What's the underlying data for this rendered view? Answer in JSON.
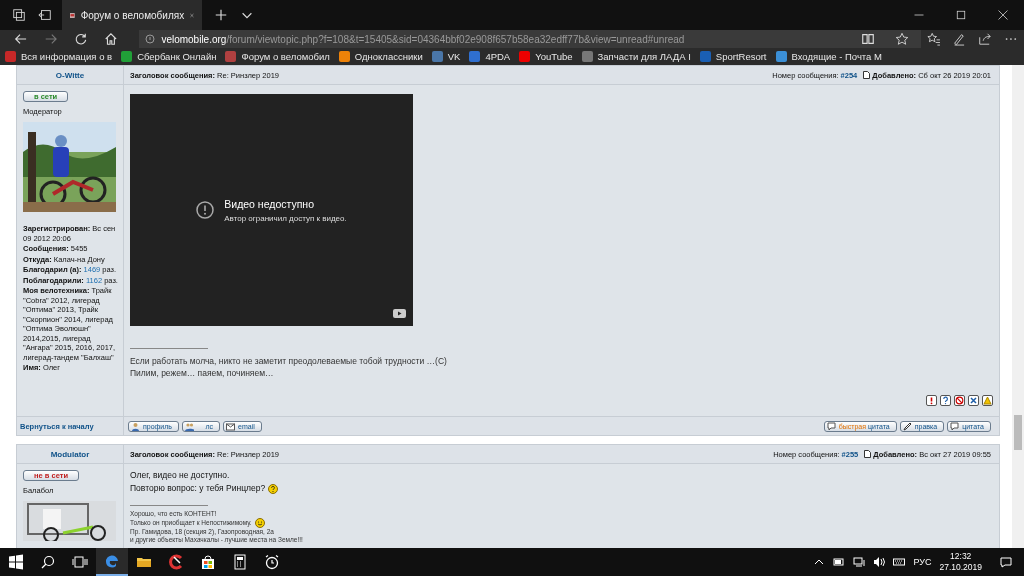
{
  "browser": {
    "tabs": [
      {
        "title": "Форум о веломобилях",
        "selected": true
      }
    ],
    "address": "**velomobile.org**/forum/viewtopic.php?f=108&t=15405&sid=04364bbf02e908f657b58ea32edff77b&view=unread#unread",
    "bookmarks": [
      "Вся информация о в",
      "Сбербанк Онлайн",
      "Форум о веломобил",
      "Одноклассники",
      "VK",
      "4PDA",
      "YouTube",
      "Запчасти для ЛАДА I",
      "SportResort",
      "Входящие - Почта M"
    ]
  },
  "posts": [
    {
      "author": "O-Witte",
      "status": {
        "label": "в сети",
        "online": true
      },
      "rank": "Модератор",
      "avatar": {
        "kind": "picture"
      },
      "profile": [
        {
          "text": "**Зарегистрирован:** Вс сен 09 2012 20:06"
        },
        {
          "text": "**Сообщения:** 5455"
        },
        {
          "text": "**Откуда:** Калач-на Дону"
        },
        {
          "text": "**Благодарил (а):**",
          "link": "1469",
          "after": "раз."
        },
        {
          "text": "**Поблагодарили:**",
          "link": "1162",
          "after": "раз."
        },
        {
          "text": "**Моя велотехника:** Трайк \"Cobra\" 2012, лигерад \"Оптима\" 2013, Трайк \"Скорпион\" 2014, лигерад \"Оптима Эволюшн\" 2014,2015, лигерад \"Ангара\" 2015, 2016, 2017, лигерад-тандем \"Балхаш\""
        },
        {
          "text": "**Имя:** Олег"
        }
      ],
      "subject_label": "Заголовок сообщения:",
      "subject": "Re: Ринзлер 2019",
      "number_label": "Номер сообщения:",
      "number": "#254",
      "added_label": "Добавлено:",
      "added": "Сб окт 26 2019 20:01",
      "video": {
        "title": "Видео недоступно",
        "message": "Автор ограничил доступ к видео."
      },
      "signature": [
        {
          "text": "Если работать молча, никто не заметит преодолеваемые тобой трудности …(C)",
          "kind": "line",
          "small": false
        },
        {
          "text": "Пилим, режем… паяем, починяем…",
          "kind": "line",
          "small": false
        }
      ],
      "footer": {
        "back": "Вернуться к началу",
        "left": [
          {
            "kind": "profile",
            "label": "профиль"
          },
          {
            "kind": "pm",
            "label": "лс"
          },
          {
            "kind": "email",
            "label": "email"
          }
        ],
        "right": [
          {
            "kind": "quick",
            "label": "**быстрая** цитата"
          },
          {
            "kind": "edit",
            "label": "правка"
          },
          {
            "kind": "quote",
            "label": "цитата"
          }
        ]
      }
    },
    {
      "author": "Modulator",
      "status": {
        "label": "не в сети",
        "online": false
      },
      "rank": "Балабол",
      "avatar": {
        "kind": "picture"
      },
      "subject_label": "Заголовок сообщения:",
      "subject": "Re: Ринзлер 2019",
      "number_label": "Номер сообщения:",
      "number": "#255",
      "added_label": "Добавлено:",
      "added": "Вс окт 27 2019 09:55",
      "text": [
        {
          "text": "Олег, видео не доступно.",
          "kind": "line"
        },
        {
          "text": "Повторю вопрос: у тебя Ринцлер?",
          "kind": "question"
        }
      ],
      "signature": [
        {
          "text": "Хорошо, что есть КОНТЕНТ!",
          "kind": "line",
          "small": true
        },
        {
          "text": "Только он приобщает к Непостижимому.",
          "kind": "smile",
          "small": true
        },
        {
          "text": "Пр. Гамидова, 18 (секция 2), Газопроводная, 2а",
          "kind": "line",
          "small": true
        },
        {
          "text": "и другие объекты Махачкалы - лучшие места на Земле!!!",
          "kind": "line",
          "small": true
        }
      ]
    }
  ],
  "taskbar": {
    "apps": [
      {
        "kind": "edge",
        "selected": true
      },
      {
        "kind": "explorer",
        "selected": false
      },
      {
        "kind": "cleaner",
        "selected": false
      },
      {
        "kind": "store",
        "selected": false
      },
      {
        "kind": "calculator",
        "selected": false
      },
      {
        "kind": "alarm",
        "selected": false
      }
    ],
    "language": "РУС",
    "time": "12:32",
    "date": "27.10.2019"
  }
}
